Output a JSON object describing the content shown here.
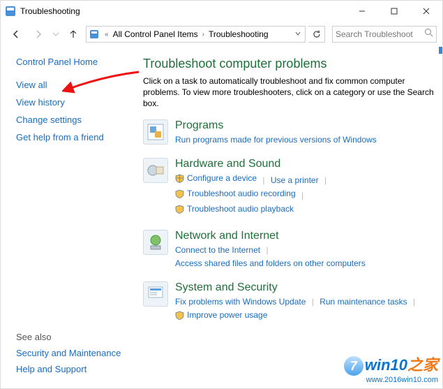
{
  "titlebar": {
    "title": "Troubleshooting"
  },
  "breadcrumb": {
    "item1": "All Control Panel Items",
    "item2": "Troubleshooting"
  },
  "search": {
    "placeholder": "Search Troubleshoot"
  },
  "sidebar": {
    "home": "Control Panel Home",
    "links": [
      "View all",
      "View history",
      "Change settings",
      "Get help from a friend"
    ],
    "seealso_header": "See also",
    "seealso": [
      "Security and Maintenance",
      "Help and Support"
    ]
  },
  "main": {
    "heading": "Troubleshoot computer problems",
    "description": "Click on a task to automatically troubleshoot and fix common computer problems. To view more troubleshooters, click on a category or use the Search box.",
    "categories": [
      {
        "title": "Programs",
        "links": [
          {
            "label": "Run programs made for previous versions of Windows",
            "shield": false
          }
        ]
      },
      {
        "title": "Hardware and Sound",
        "links": [
          {
            "label": "Configure a device",
            "shield": true
          },
          {
            "label": "Use a printer",
            "shield": false
          },
          {
            "label": "Troubleshoot audio recording",
            "shield": true
          },
          {
            "label": "Troubleshoot audio playback",
            "shield": true
          }
        ]
      },
      {
        "title": "Network and Internet",
        "links": [
          {
            "label": "Connect to the Internet",
            "shield": false
          },
          {
            "label": "Access shared files and folders on other computers",
            "shield": false
          }
        ]
      },
      {
        "title": "System and Security",
        "links": [
          {
            "label": "Fix problems with Windows Update",
            "shield": false
          },
          {
            "label": "Run maintenance tasks",
            "shield": false
          },
          {
            "label": "Improve power usage",
            "shield": true
          }
        ]
      }
    ]
  },
  "watermark": {
    "brand1": "win10",
    "brand2": "之家",
    "url": "www.2016win10.com"
  }
}
